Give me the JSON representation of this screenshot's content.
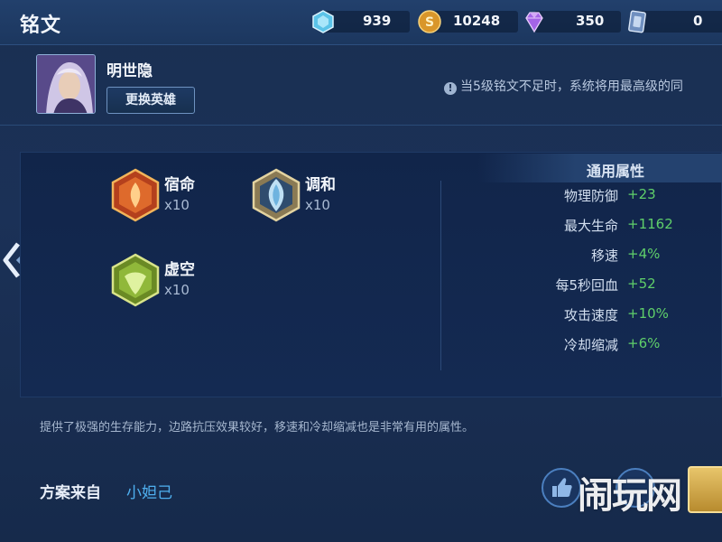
{
  "header": {
    "title": "铭文"
  },
  "currencies": [
    {
      "icon": "diamond-icon",
      "value": "939",
      "color": "#7fd0f0"
    },
    {
      "icon": "gold-coin-icon",
      "value": "10248",
      "color": "#e9a93a"
    },
    {
      "icon": "gem-icon",
      "value": "350",
      "color": "#b06be8"
    },
    {
      "icon": "card-icon",
      "value": "0",
      "color": "#9fb7da"
    }
  ],
  "hero": {
    "name": "明世隐",
    "change_button": "更换英雄",
    "notice": "当5级铭文不足时，系统将用最高级的同"
  },
  "runes": [
    {
      "name": "宿命",
      "count": "x10",
      "color": "#d0572a"
    },
    {
      "name": "调和",
      "count": "x10",
      "color": "#b7cde0"
    },
    {
      "name": "虚空",
      "count": "x10",
      "color": "#8fbf3a"
    }
  ],
  "attributes": {
    "title": "通用属性",
    "rows": [
      {
        "label": "物理防御",
        "value": "+23"
      },
      {
        "label": "最大生命",
        "value": "+1162"
      },
      {
        "label": "移速",
        "value": "+4%"
      },
      {
        "label": "每5秒回血",
        "value": "+52"
      },
      {
        "label": "攻击速度",
        "value": "+10%"
      },
      {
        "label": "冷却缩减",
        "value": "+6%"
      }
    ]
  },
  "description": "提供了极强的生存能力，边路抗压效果较好，移速和冷却缩减也是非常有用的属性。",
  "source": {
    "label": "方案来自",
    "name": "小妲己"
  },
  "watermark": "闹玩网"
}
